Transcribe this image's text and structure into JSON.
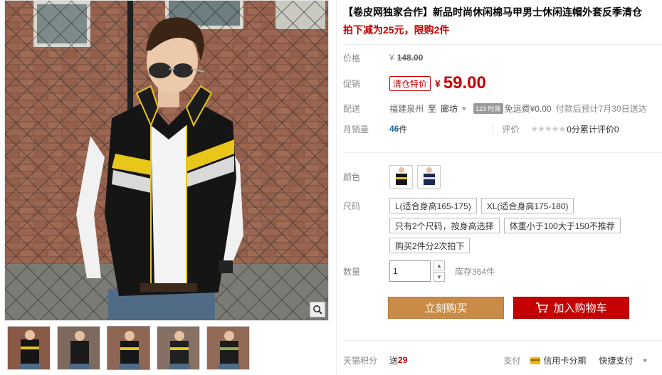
{
  "product": {
    "title": "【卷皮网独家合作】新品时尚休闲棉马甲男士休闲连帽外套反季清仓",
    "subtitle": "拍下减为25元，限购2件"
  },
  "price": {
    "label": "价格",
    "currency": "¥",
    "original": "148.00"
  },
  "promo": {
    "label": "促销",
    "tag": "清仓特价",
    "currency": "¥",
    "value": "59.00"
  },
  "delivery": {
    "label": "配送",
    "from": "福建泉州",
    "to_word": "至",
    "to": "廊坊",
    "badge": "123 时效",
    "fee": "免运费¥0.00",
    "note": "付款后预计7月30日送达"
  },
  "sales": {
    "label": "月销量",
    "count": "46",
    "unit": "件",
    "review_label": "评价",
    "stars": "★★★★★",
    "score": "0分",
    "reviews": "累计评价0"
  },
  "color": {
    "label": "颜色"
  },
  "size": {
    "label": "尺码",
    "options": [
      "L(适合身高165-175)",
      "XL(适合身高175-180)",
      "只有2个尺码，按身高选择",
      "体重小于100大于150不推荐",
      "购买2件分2次拍下"
    ]
  },
  "quantity": {
    "label": "数量",
    "value": "1",
    "stock": "库存364件",
    "up": "▲",
    "down": "▼"
  },
  "actions": {
    "buy": "立刻购买",
    "cart": "加入购物车"
  },
  "footer": {
    "points_label": "天猫积分",
    "points_prefix": "送",
    "points_value": "29",
    "pay_label": "支付",
    "credit": "信用卡分期",
    "quick_pay": "快捷支付"
  },
  "colors": {
    "accent_red": "#c40000",
    "buy_orange": "#c98b47",
    "link_blue": "#1e6aa8"
  }
}
